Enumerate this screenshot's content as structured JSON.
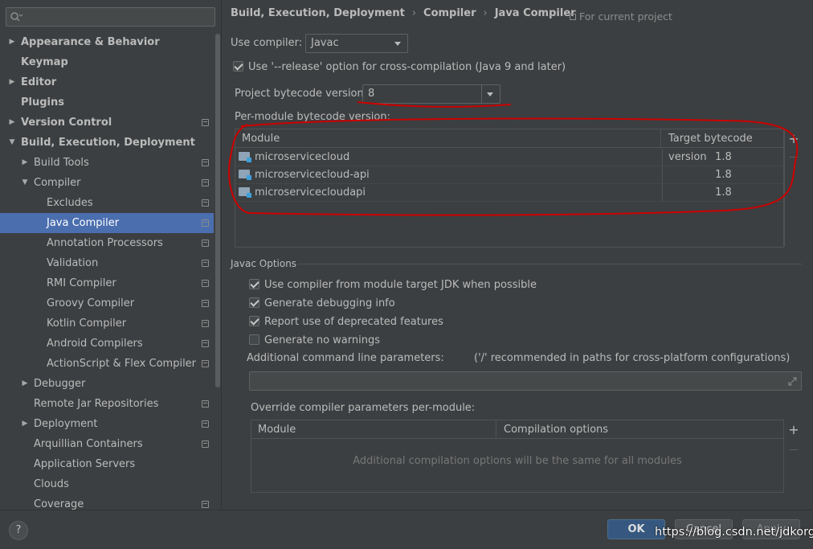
{
  "sidebar": {
    "search_placeholder": "",
    "items": [
      {
        "label": "Appearance & Behavior",
        "level": 0,
        "arrow": "right",
        "bold": true,
        "proj": false
      },
      {
        "label": "Keymap",
        "level": 0,
        "arrow": "",
        "bold": true,
        "proj": false
      },
      {
        "label": "Editor",
        "level": 0,
        "arrow": "right",
        "bold": true,
        "proj": false
      },
      {
        "label": "Plugins",
        "level": 0,
        "arrow": "",
        "bold": true,
        "proj": false
      },
      {
        "label": "Version Control",
        "level": 0,
        "arrow": "right",
        "bold": true,
        "proj": true
      },
      {
        "label": "Build, Execution, Deployment",
        "level": 0,
        "arrow": "down",
        "bold": true,
        "proj": false
      },
      {
        "label": "Build Tools",
        "level": 1,
        "arrow": "right",
        "bold": false,
        "proj": true
      },
      {
        "label": "Compiler",
        "level": 1,
        "arrow": "down",
        "bold": false,
        "proj": true
      },
      {
        "label": "Excludes",
        "level": 2,
        "arrow": "",
        "bold": false,
        "proj": true
      },
      {
        "label": "Java Compiler",
        "level": 2,
        "arrow": "",
        "bold": false,
        "proj": true,
        "selected": true
      },
      {
        "label": "Annotation Processors",
        "level": 2,
        "arrow": "",
        "bold": false,
        "proj": true
      },
      {
        "label": "Validation",
        "level": 2,
        "arrow": "",
        "bold": false,
        "proj": true
      },
      {
        "label": "RMI Compiler",
        "level": 2,
        "arrow": "",
        "bold": false,
        "proj": true
      },
      {
        "label": "Groovy Compiler",
        "level": 2,
        "arrow": "",
        "bold": false,
        "proj": true
      },
      {
        "label": "Kotlin Compiler",
        "level": 2,
        "arrow": "",
        "bold": false,
        "proj": true
      },
      {
        "label": "Android Compilers",
        "level": 2,
        "arrow": "",
        "bold": false,
        "proj": true
      },
      {
        "label": "ActionScript & Flex Compiler",
        "level": 2,
        "arrow": "",
        "bold": false,
        "proj": true
      },
      {
        "label": "Debugger",
        "level": 1,
        "arrow": "right",
        "bold": false,
        "proj": false
      },
      {
        "label": "Remote Jar Repositories",
        "level": 1,
        "arrow": "",
        "bold": false,
        "proj": true
      },
      {
        "label": "Deployment",
        "level": 1,
        "arrow": "right",
        "bold": false,
        "proj": true
      },
      {
        "label": "Arquillian Containers",
        "level": 1,
        "arrow": "",
        "bold": false,
        "proj": true
      },
      {
        "label": "Application Servers",
        "level": 1,
        "arrow": "",
        "bold": false,
        "proj": false
      },
      {
        "label": "Clouds",
        "level": 1,
        "arrow": "",
        "bold": false,
        "proj": false
      },
      {
        "label": "Coverage",
        "level": 1,
        "arrow": "",
        "bold": false,
        "proj": true
      }
    ]
  },
  "breadcrumb": {
    "parts": [
      "Build, Execution, Deployment",
      "Compiler",
      "Java Compiler"
    ],
    "separator": "›",
    "for_project": "For current project"
  },
  "compiler": {
    "use_label": "Use compiler:",
    "value": "Javac"
  },
  "release_option": {
    "label": "Use '--release' option for cross-compilation (Java 9 and later)",
    "checked": true
  },
  "bytecode": {
    "label": "Project bytecode version:",
    "value": "8"
  },
  "per_module": {
    "label": "Per-module bytecode version:",
    "col_module": "Module",
    "col_target": "Target bytecode version",
    "rows": [
      {
        "module": "microservicecloud",
        "version": "1.8"
      },
      {
        "module": "microservicecloud-api",
        "version": "1.8"
      },
      {
        "module": "microservicecloudapi",
        "version": "1.8"
      }
    ],
    "add": "+",
    "remove": "—"
  },
  "javac": {
    "title": "Javac Options",
    "options": [
      {
        "label": "Use compiler from module target JDK when possible",
        "checked": true
      },
      {
        "label": "Generate debugging info",
        "checked": true
      },
      {
        "label": "Report use of deprecated features",
        "checked": true
      },
      {
        "label": "Generate no warnings",
        "checked": false
      }
    ],
    "params_label": "Additional command line parameters:",
    "params_hint": "('/' recommended in paths for cross-platform configurations)",
    "params_value": ""
  },
  "override": {
    "label": "Override compiler parameters per-module:",
    "col_module": "Module",
    "col_options": "Compilation options",
    "empty_text": "Additional compilation options will be the same for all modules",
    "add": "+",
    "remove": "—"
  },
  "footer": {
    "help": "?",
    "ok": "OK",
    "cancel": "Cancel",
    "apply": "Apply"
  },
  "watermark": "https://blog.csdn.net/jdkorg",
  "colors": {
    "background": "#3c3f41",
    "selection": "#4b6eaf",
    "ok_button": "#365880",
    "annotation": "#cc0000"
  }
}
